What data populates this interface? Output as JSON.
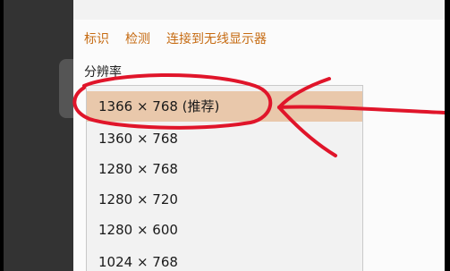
{
  "header_links": [
    "标识",
    "检测",
    "连接到无线显示器"
  ],
  "resolution_label": "分辨率",
  "resolutions": [
    {
      "label": "1366 × 768 (推荐)",
      "selected": true
    },
    {
      "label": "1360 × 768",
      "selected": false
    },
    {
      "label": "1280 × 768",
      "selected": false
    },
    {
      "label": "1280 × 720",
      "selected": false
    },
    {
      "label": "1280 × 600",
      "selected": false
    },
    {
      "label": "1024 × 768",
      "selected": false
    }
  ],
  "colors": {
    "link": "#c66b12",
    "selected_bg": "#e9c8ab",
    "annotation": "#e0152a"
  }
}
